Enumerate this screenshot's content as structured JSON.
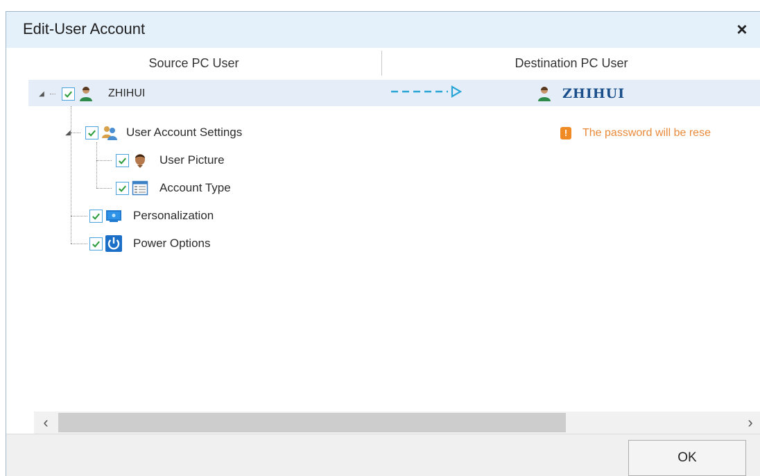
{
  "dialog": {
    "title": "Edit-User Account",
    "close_label": "×"
  },
  "columns": {
    "source": "Source PC User",
    "destination": "Destination PC User"
  },
  "tree": {
    "root": {
      "label": "ZHIHUI",
      "checked": true,
      "icon": "user-icon"
    },
    "items": [
      {
        "label": "User Account Settings",
        "checked": true,
        "icon": "users-icon"
      },
      {
        "label": "User Picture",
        "checked": true,
        "icon": "user-picture-icon"
      },
      {
        "label": "Account Type",
        "checked": true,
        "icon": "account-type-icon"
      },
      {
        "label": "Personalization",
        "checked": true,
        "icon": "monitor-icon"
      },
      {
        "label": "Power Options",
        "checked": true,
        "icon": "power-icon"
      }
    ]
  },
  "destination": {
    "user": "ZHIHUI",
    "warning_badge": "!",
    "warning_text": "The password will be rese"
  },
  "scrollbar": {
    "left_arrow": "‹",
    "right_arrow": "›"
  },
  "footer": {
    "ok_label": "OK"
  },
  "colors": {
    "title_bar": "#e4f0fa",
    "selection": "#e5eef8",
    "checkbox_border": "#4aa3df",
    "check": "#2a9d3a",
    "arrow": "#29a4d6",
    "dest_name": "#1a4f8c",
    "warning": "#f08a24"
  }
}
